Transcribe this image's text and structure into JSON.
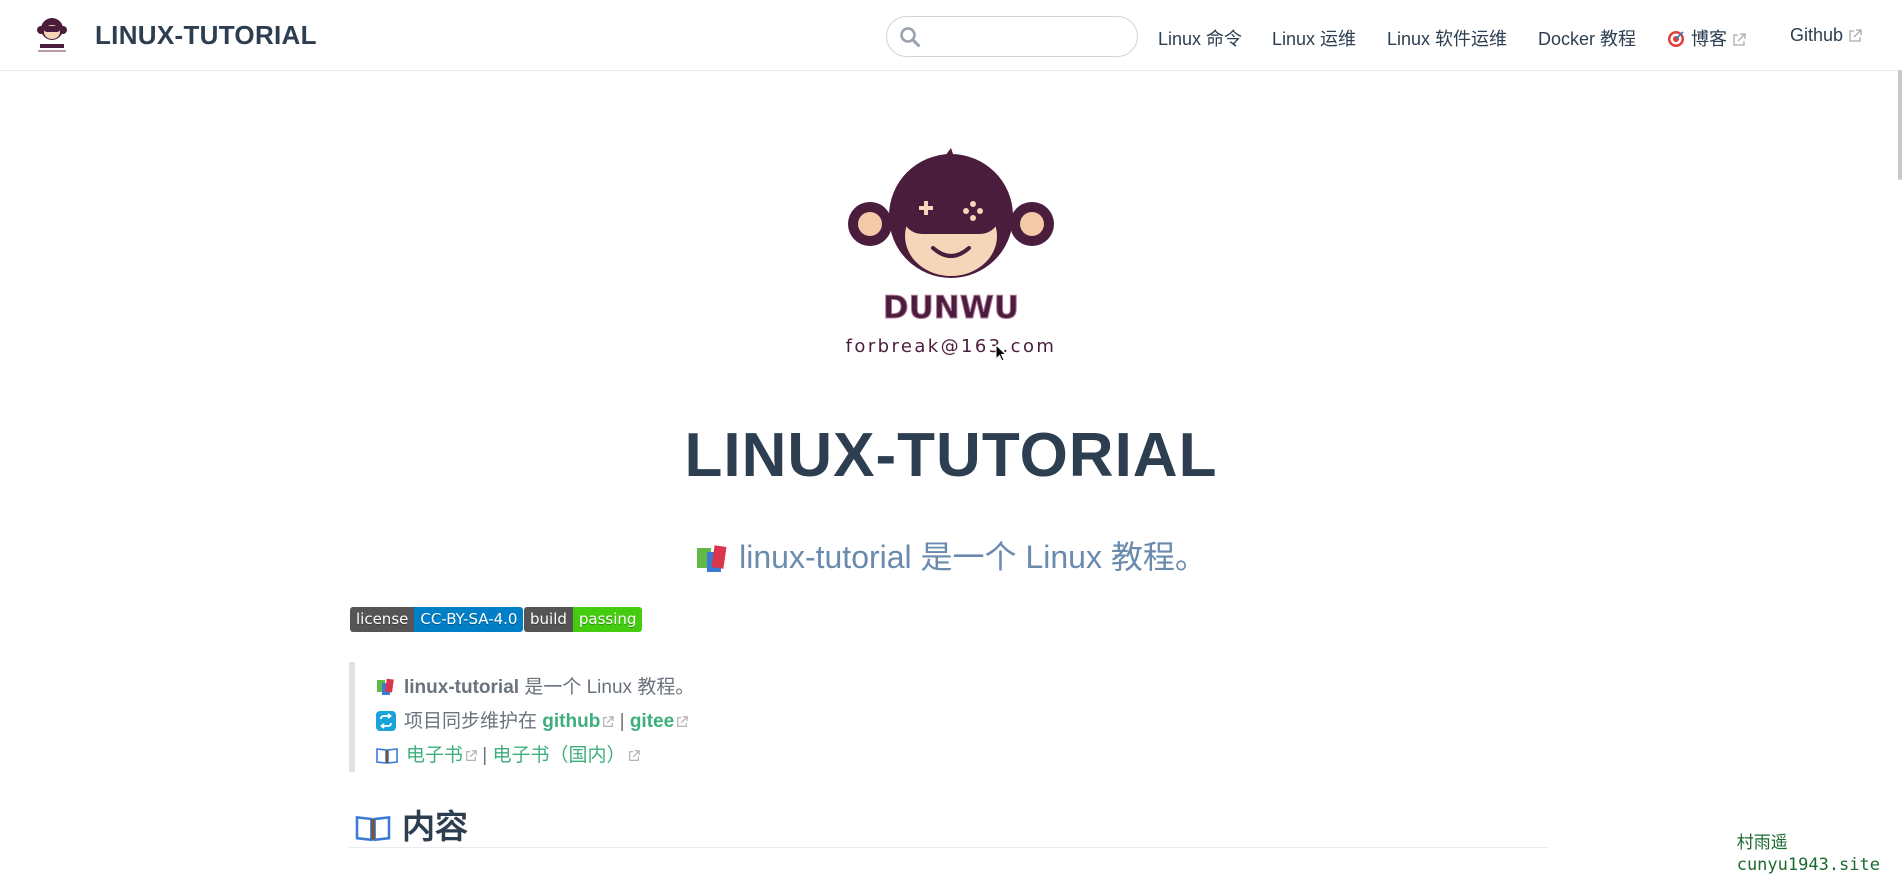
{
  "header": {
    "site_name": "LINUX-TUTORIAL",
    "search": {
      "placeholder": "",
      "value": ""
    },
    "nav": [
      {
        "label": "Linux 命令",
        "external": false
      },
      {
        "label": "Linux 运维",
        "external": false
      },
      {
        "label": "Linux 软件运维",
        "external": false
      },
      {
        "label": "Docker 教程",
        "external": false
      },
      {
        "label": "博客",
        "external": true,
        "icon": "target-icon"
      },
      {
        "label": "Github",
        "external": true
      }
    ]
  },
  "hero": {
    "logo_name": "DUNWU",
    "logo_email": "forbreak@163.com",
    "title": "LINUX-TUTORIAL",
    "description": "linux-tutorial 是一个 Linux 教程。"
  },
  "badges": [
    {
      "left": "license",
      "right": "CC-BY-SA-4.0",
      "color": "#007ec6"
    },
    {
      "left": "build",
      "right": "passing",
      "color": "#4c1"
    }
  ],
  "quote": {
    "line1_bold": "linux-tutorial",
    "line1_rest": " 是一个 Linux 教程。",
    "line2_prefix": "项目同步维护在 ",
    "line2_link1": "github",
    "line2_sep": " | ",
    "line2_link2": "gitee",
    "line3_link1": "电子书",
    "line3_sep": " | ",
    "line3_link2": "电子书（国内）"
  },
  "section": {
    "title": "内容"
  },
  "watermark": {
    "line1": "村雨遥",
    "line2": "cunyu1943.site"
  },
  "colors": {
    "text": "#2c3e50",
    "accent": "#3eaf7c",
    "muted": "#6a8bad"
  }
}
